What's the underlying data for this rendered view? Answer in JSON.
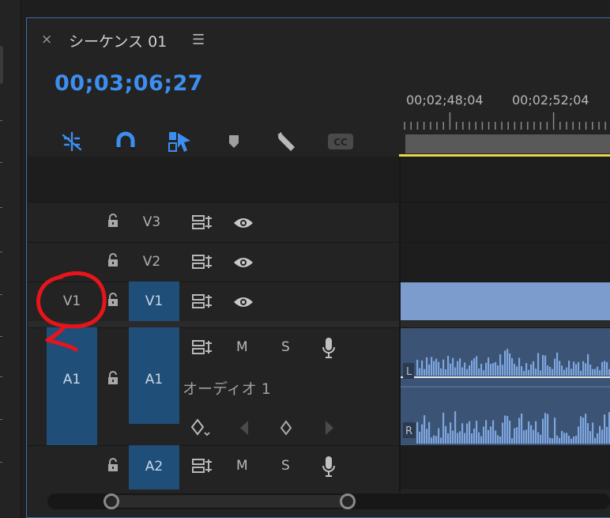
{
  "panel": {
    "close_symbol": "×",
    "title": "シーケンス 01",
    "menu_symbol": "☰",
    "timecode": "00;03;06;27"
  },
  "ruler": {
    "labels": [
      "00;02;48;04",
      "00;02;52;04"
    ]
  },
  "toolbar": {
    "tools": [
      "nest-icon",
      "snap-magnet-icon",
      "linked-selection-icon",
      "add-marker-icon",
      "wrench-icon",
      "closed-captions-icon"
    ],
    "cc_label": "CC"
  },
  "tracks": {
    "v3": {
      "target": "V3"
    },
    "v2": {
      "target": "V2"
    },
    "v1": {
      "source": "V1",
      "target": "V1"
    },
    "a1": {
      "source": "A1",
      "target": "A1",
      "mute": "M",
      "solo": "S",
      "name": "オーディオ 1",
      "channel_left": "L",
      "channel_right": "R"
    },
    "a2": {
      "target": "A2",
      "mute": "M",
      "solo": "S"
    }
  },
  "colors": {
    "timecode": "#3c8ff0",
    "target_blue": "#1f4e78",
    "video_clip": "#7b9ccc",
    "audio_clip": "#3b5374",
    "waveform": "#7ea6de",
    "playhead_range": "#e8d84a",
    "annotation": "#e8141c"
  }
}
